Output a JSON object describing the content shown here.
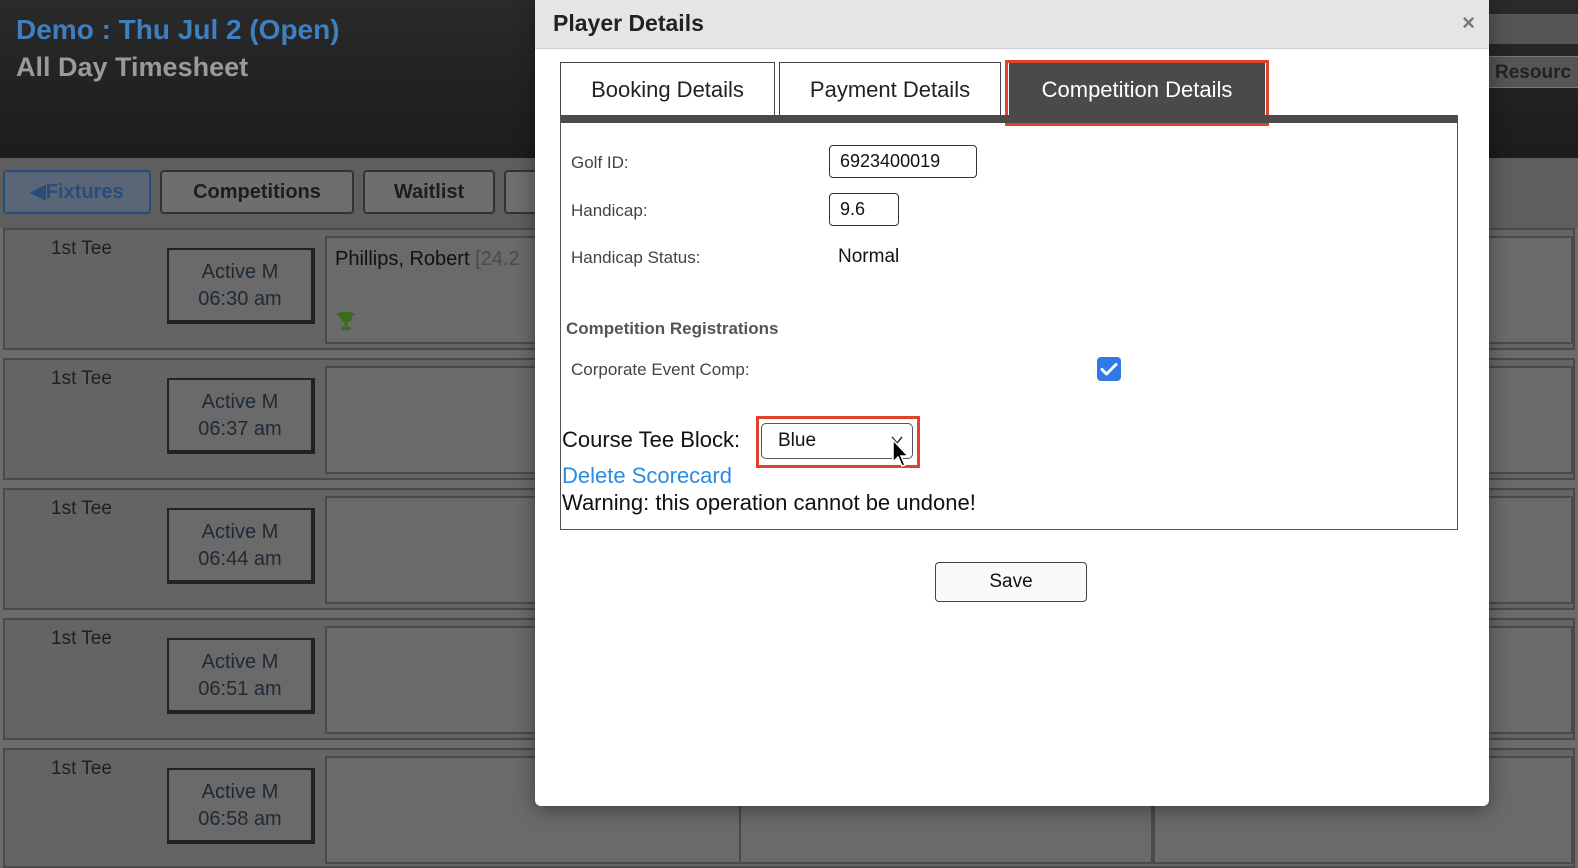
{
  "page": {
    "title": "Demo : Thu Jul 2 (Open)",
    "subtitle": "All Day Timesheet",
    "resource_tab_label": "Resourc"
  },
  "nav": {
    "fixtures_label": "Fixtures",
    "competitions_label": "Competitions",
    "waitlist_label": "Waitlist"
  },
  "tee_rows": [
    {
      "tee": "1st Tee",
      "slot_line1": "Active M",
      "slot_line2": "06:30 am",
      "player": "Phillips, Robert",
      "player_hcp": "[24.2"
    },
    {
      "tee": "1st Tee",
      "slot_line1": "Active M",
      "slot_line2": "06:37 am",
      "player": "",
      "player_hcp": ""
    },
    {
      "tee": "1st Tee",
      "slot_line1": "Active M",
      "slot_line2": "06:44 am",
      "player": "",
      "player_hcp": ""
    },
    {
      "tee": "1st Tee",
      "slot_line1": "Active M",
      "slot_line2": "06:51 am",
      "player": "",
      "player_hcp": ""
    },
    {
      "tee": "1st Tee",
      "slot_line1": "Active M",
      "slot_line2": "06:58 am",
      "player": "",
      "player_hcp": ""
    }
  ],
  "modal": {
    "title": "Player Details",
    "close_symbol": "×",
    "tabs": [
      {
        "label": "Booking Details",
        "active": false
      },
      {
        "label": "Payment Details",
        "active": false
      },
      {
        "label": "Competition Details",
        "active": true
      }
    ],
    "golf_id_label": "Golf ID:",
    "golf_id_value": "6923400019",
    "handicap_label": "Handicap:",
    "handicap_value": "9.6",
    "handicap_status_label": "Handicap Status:",
    "handicap_status_value": "Normal",
    "registrations_heading": "Competition Registrations",
    "corporate_event_label": "Corporate Event Comp:",
    "corporate_event_checked": true,
    "tee_block_label": "Course Tee Block:",
    "tee_block_value": "Blue",
    "delete_link": "Delete Scorecard",
    "warning": "Warning: this operation cannot be undone!",
    "save_label": "Save"
  },
  "colors": {
    "highlight": "#e0432d",
    "link": "#2b8ae3",
    "checkbox": "#2f7ae5",
    "active_tab": "#4a4a4a"
  }
}
